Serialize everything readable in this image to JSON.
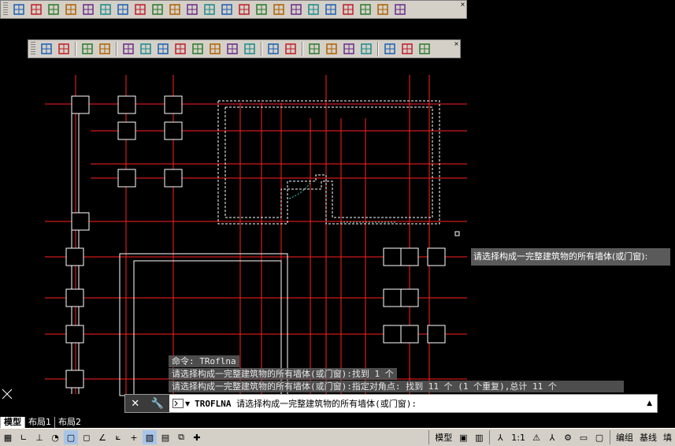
{
  "toolbar1": {
    "icons": [
      "building-icon",
      "edit-icon",
      "layers-icon",
      "grid-icon",
      "axis-icon",
      "dimension-icon",
      "column-icon",
      "wall-icon",
      "door-window-icon",
      "room-icon",
      "area-icon",
      "table-icon",
      "frame-icon",
      "stair-icon",
      "envelope-icon",
      "print-icon",
      "book-icon",
      "ppt-icon",
      "elevation-icon",
      "level-icon",
      "text-icon",
      "target-icon",
      "help-icon"
    ]
  },
  "toolbar2": {
    "icons": [
      "select-icon",
      "zoom-icon",
      "list-icon",
      "image-icon",
      "leader-icon",
      "dim-icon",
      "sym-icon",
      "elev-icon",
      "text-icon",
      "level-icon",
      "note-icon",
      "table-icon",
      "mark-icon",
      "drawer-icon",
      "layout-icon",
      "eye-icon",
      "pen-icon",
      "eye2-icon",
      "window-icon",
      "panel-icon",
      "tool-icon"
    ]
  },
  "command_history": [
    "命令: TRoflna",
    "请选择构成一完整建筑物的所有墙体(或门窗):找到 1 个",
    "请选择构成一完整建筑物的所有墙体(或门窗):指定对角点: 找到 11 个 (1 个重复),总计 11 个"
  ],
  "command_line": {
    "command": "TROFLNA",
    "prompt": "请选择构成一完整建筑物的所有墙体(或门窗):"
  },
  "tooltip": "请选择构成一完整建筑物的所有墙体(或门窗):",
  "tabs": [
    "模型",
    "布局1",
    "布局2"
  ],
  "status": {
    "model_label": "模型",
    "scale_label": "1:1",
    "group_label": "编组",
    "baseline_label": "基线",
    "fill_label": "填"
  },
  "colors": {
    "axis_line": "#ff2020",
    "wall": "#ffffff",
    "selection": "#ffffff",
    "door": "#40d0c0"
  }
}
